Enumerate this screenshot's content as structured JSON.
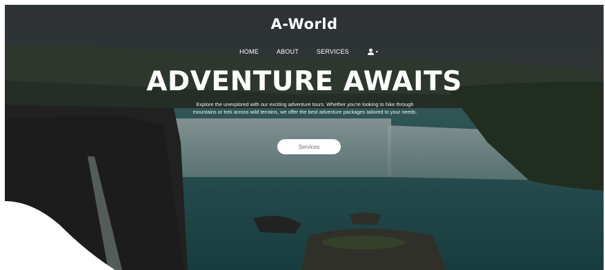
{
  "brand": {
    "name": "A-World"
  },
  "nav": {
    "items": [
      {
        "label": "HOME"
      },
      {
        "label": "ABOUT"
      },
      {
        "label": "SERVICES"
      }
    ],
    "user_icon": "user-icon",
    "user_caret": "▾"
  },
  "hero": {
    "headline": "ADVENTURE AWAITS",
    "description": "Explore the unexplored with our exciting adventure tours. Whether you're looking to hike through mountains or trek across wild terrains, we offer the best adventure packages tailored to your needs.",
    "button_label": "Services"
  },
  "colors": {
    "overlay": "#1e2629",
    "water": "#2f6f6e",
    "text": "#ffffff",
    "button_bg": "#ffffff",
    "button_text": "#6a6a6a"
  }
}
